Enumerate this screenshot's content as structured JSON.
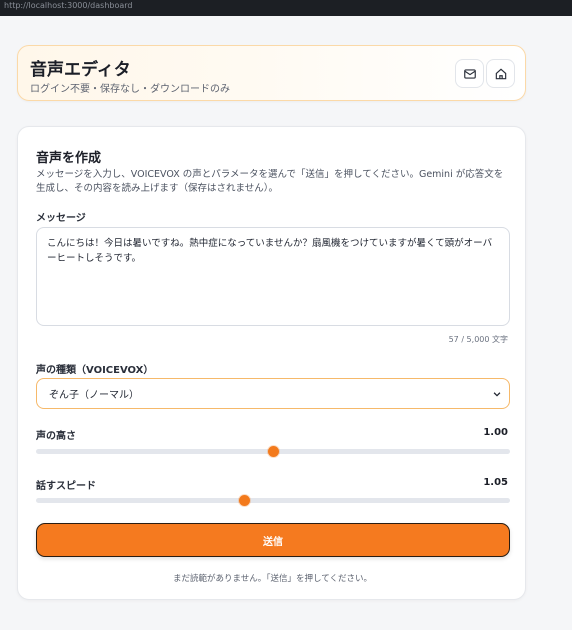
{
  "browser": {
    "url": "http://localhost:3000/dashboard"
  },
  "header": {
    "title": "音声エディタ",
    "subtitle": "ログイン不要・保存なし・ダウンロードのみ",
    "icons": [
      "mail-icon",
      "home-icon"
    ]
  },
  "card": {
    "title": "音声を作成",
    "description": "メッセージを入力し、VOICEVOX の声とパラメータを選んで「送信」を押してください。Gemini が応答文を生成し、その内容を読み上げます（保存はされません）。",
    "message": {
      "label": "メッセージ",
      "value": "こんにちは！今日は暑いですね。熱中症になっていませんか？扇風機をつけていますが暑くて頭がオーバーヒートしそうです。",
      "counter": "57 / 5,000 文字"
    },
    "voice": {
      "label": "声の種類（VOICEVOX）",
      "selected": "ぞん子（ノーマル）"
    },
    "pitch": {
      "label": "声の高さ",
      "value_text": "1.00",
      "position": 0.5
    },
    "speed": {
      "label": "話すスピード",
      "value_text": "1.05",
      "position": 0.44
    },
    "send_label": "送信",
    "empty_note": "まだ読範がありません。「送信」を押してください。"
  },
  "colors": {
    "accent": "#f57a1f",
    "header_border": "#fbd9a8",
    "select_border": "#f6b96a"
  }
}
